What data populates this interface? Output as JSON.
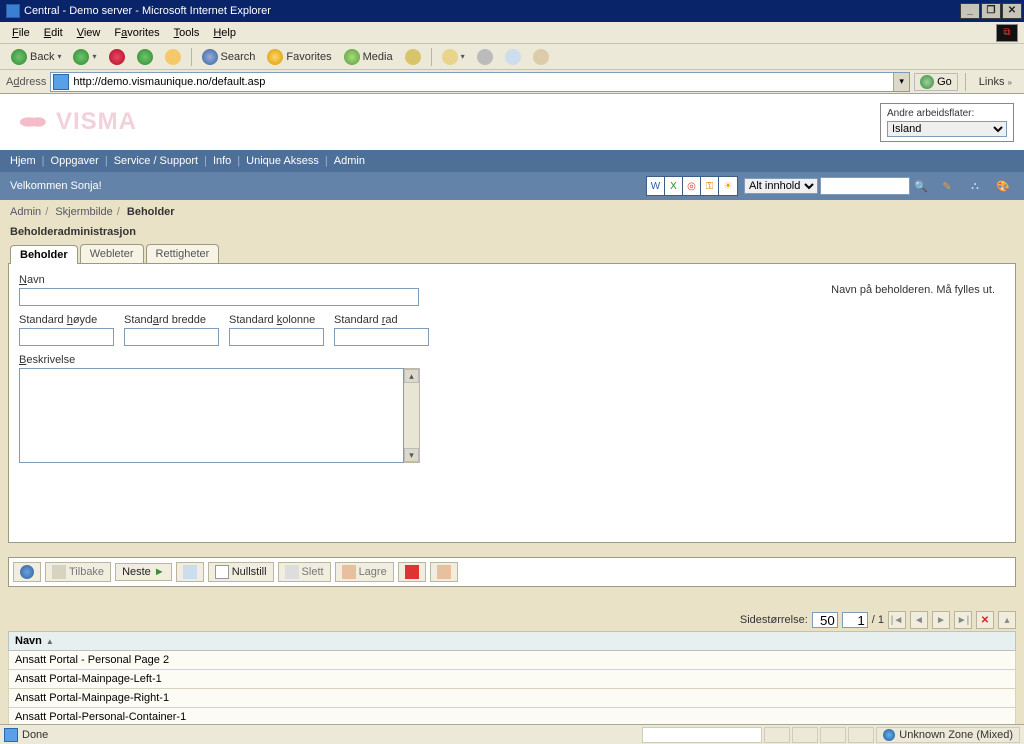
{
  "window": {
    "title": "Central - Demo server - Microsoft Internet Explorer"
  },
  "menu": {
    "file": "File",
    "edit": "Edit",
    "view": "View",
    "favorites": "Favorites",
    "tools": "Tools",
    "help": "Help"
  },
  "toolbar": {
    "back": "Back",
    "search": "Search",
    "favorites": "Favorites",
    "media": "Media"
  },
  "address": {
    "label": "Address",
    "url": "http://demo.vismaunique.no/default.asp",
    "go": "Go",
    "links": "Links"
  },
  "brand": {
    "logo": "VISMA"
  },
  "workspace": {
    "label": "Andre arbeidsflater:",
    "selected": "Island"
  },
  "nav": {
    "items": [
      "Hjem",
      "Oppgaver",
      "Service / Support",
      "Info",
      "Unique Aksess",
      "Admin"
    ]
  },
  "welcome": "Velkommen Sonja!",
  "search": {
    "scope": "Alt innhold"
  },
  "breadcrumb": {
    "a": "Admin",
    "b": "Skjermbilde",
    "c": "Beholder"
  },
  "section_title": "Beholderadministrasjon",
  "tabs": {
    "t1": "Beholder",
    "t2": "Webleter",
    "t3": "Rettigheter"
  },
  "form": {
    "name_label": "Navn",
    "hint": "Navn på beholderen. Må fylles ut.",
    "std_h": "Standard høyde",
    "std_b": "Standard bredde",
    "std_k": "Standard kolonne",
    "std_r": "Standard rad",
    "desc": "Beskrivelse"
  },
  "actions": {
    "back": "Tilbake",
    "next": "Neste",
    "reset": "Nullstill",
    "delete": "Slett",
    "save": "Lagre"
  },
  "grid": {
    "pagesize_label": "Sidestørrelse:",
    "pagesize": "50",
    "page": "1",
    "pages": "/ 1",
    "col": "Navn",
    "rows": [
      "Ansatt Portal - Personal Page 2",
      "Ansatt Portal-Mainpage-Left-1",
      "Ansatt Portal-Mainpage-Right-1",
      "Ansatt Portal-Personal-Container-1"
    ]
  },
  "status": {
    "done": "Done",
    "zone": "Unknown Zone (Mixed)"
  }
}
